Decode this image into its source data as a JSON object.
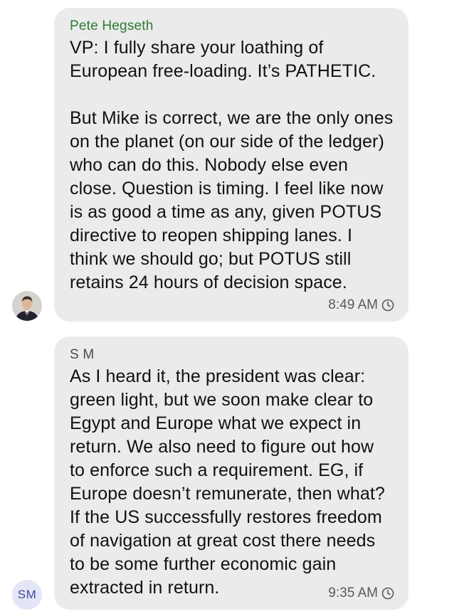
{
  "messages": [
    {
      "sender": "Pete Hegseth",
      "lines": [
        "VP: I fully share your loathing of",
        "European free-loading. It’s PATHETIC.",
        "",
        "But Mike is correct, we are the only ones",
        "on the planet (on our side of the ledger)",
        "who can do this. Nobody else even",
        "close. Question is timing. I feel like now",
        "is as good a time as any, given POTUS",
        "directive to reopen shipping lanes. I",
        "think we should go; but POTUS still",
        "retains 24 hours of decision space."
      ],
      "time": "8:49 AM",
      "avatar_icon": "person-photo"
    },
    {
      "sender": "S M",
      "lines": [
        "As I heard it, the president was clear:",
        "green light, but we soon make clear to",
        "Egypt and Europe what we expect in",
        "return. We also need to figure out how",
        "to enforce such a requirement. EG, if",
        "Europe doesn’t remunerate, then what?",
        "If the US successfully restores freedom",
        "of navigation at great cost there needs",
        "to be some further economic gain",
        "extracted in return."
      ],
      "time": "9:35 AM",
      "avatar_initials": "SM"
    }
  ],
  "colors": {
    "bubble": "#ebebeb",
    "sender_1": "#2e7d32",
    "sender_2": "#4a4a4a",
    "text": "#111111",
    "timestamp": "#5a5a5a",
    "avatar_bg": "#e4e5f7",
    "avatar_text": "#3f4b9a"
  }
}
